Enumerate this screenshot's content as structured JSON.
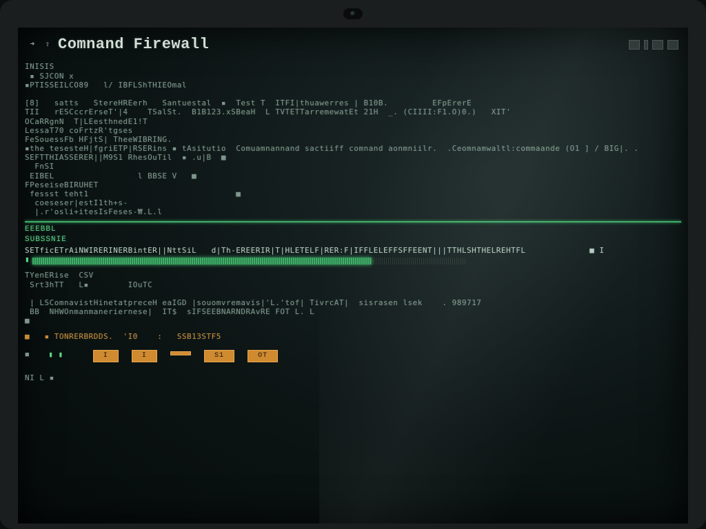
{
  "window": {
    "title": "Comnand Firewall",
    "prompt_icon": "➜",
    "pin_icon": "⇧"
  },
  "term": {
    "block1": "INISIS\n ▪ SJCON x\n▪PTISSEILCO89   l/ IBFLShTHIEOmal\n\n[8]   satts   StereHREerh   Santuestal  ▪  Test T  ITFI|thuawerres | B10B.         EFpErerE\nTII   rESCccrErseT'|4    TSalSt.  B1B123.xSBeaH  L TVTETTarremewatEt 21H  _. (CIIII:F1.O)0.)   XIT'\nOCaRRgnN  T|LEesthnedE1!T\nLessaT70 coFrtzR'tgses\nFeSouessFb HFjtS| TheeWIBRING.\n▪the tesesteH|fgriETP|RSERins ▪ tAsitutio  Comuamnannand sactiiff comnand aonmniilr.  .Ceomnamwaltl:commaande (O1 ] / BIG|. .\nSEFTTHIASSERER||M9S1 RhesOuTil  ▪ .u|B  ■\n  FnSI\n EIBEL                 l BBSE V   ■\nFPeseiseBIRUHET\n fessst teht1                              ■\n  coeseser|estI1th+s-\n  |.r'osli+itesIsFeses-₩.L.l",
    "sep_label1": "EEEBBL",
    "sep_label2": "SUBSSNIE",
    "block2": "SETficETrAiNWIRERINERBintER||NttSiL   d|Th-EREERIR|T|HLETELF|RER:F|IFFLELEFFSFFEENT|||TTHLSHTHELREHTFL             ■ I",
    "block3": "TYenERise  CSV\n Srt3hTT   L▪        IOuTC\n\n | LSComnavistHinetatpreceH eaIGD |souomvremavis|'L.'tof| TivrcAT|  sisrasen lsek    . 989717\n BB  NHWOnmanmaneriernese|  IT$  sIFSEEBNARNDRAvRE FOT L. L\n■",
    "stats_line": "■   ▪ TONRERBRDDS.  'I0    :   SSB13STF5",
    "chips": [
      "I",
      "I",
      "",
      "S1",
      "OT"
    ],
    "footer": "NI L ▪"
  },
  "progress": {
    "percent": 78
  },
  "colors": {
    "accent_green": "#3fae68",
    "accent_amber": "#d08a30"
  }
}
